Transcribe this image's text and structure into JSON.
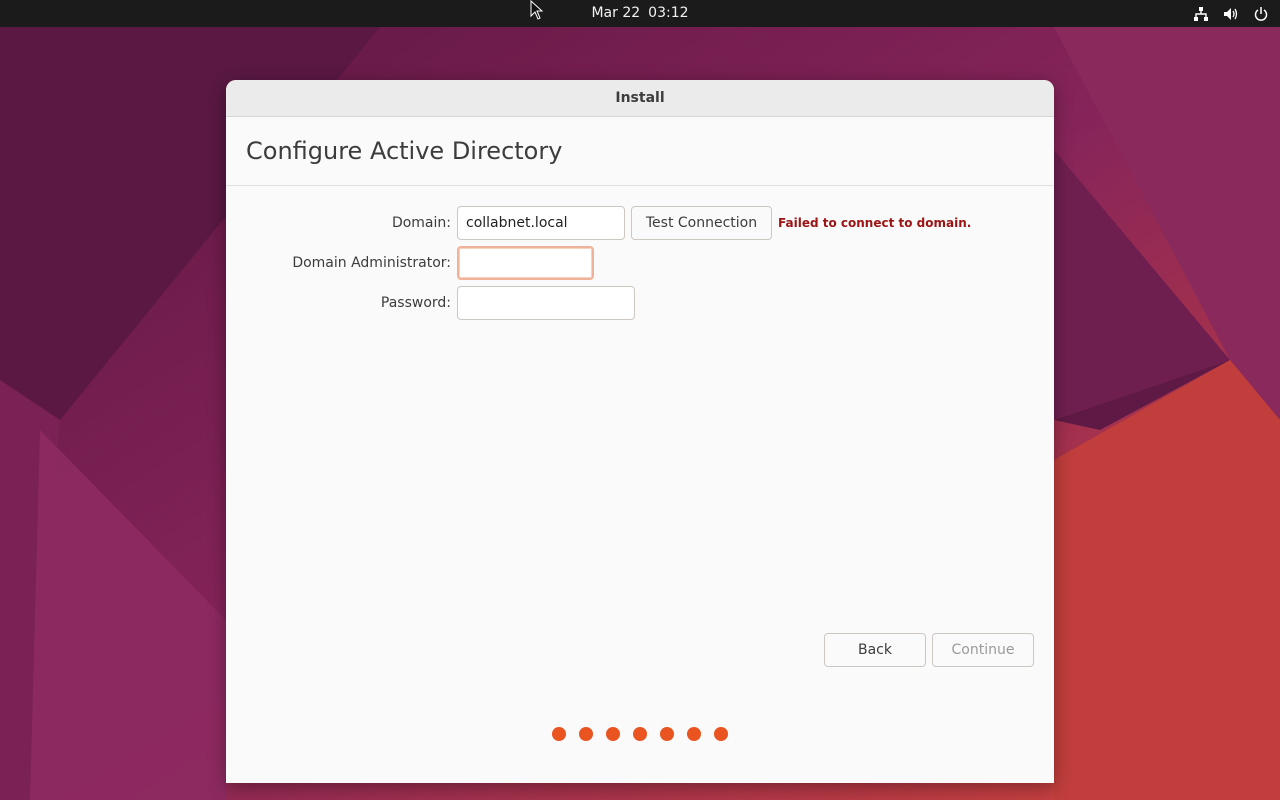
{
  "topbar": {
    "date": "Mar 22",
    "time": "03:12",
    "icons": [
      "network-icon",
      "volume-icon",
      "power-icon"
    ]
  },
  "window": {
    "title": "Install",
    "page_title": "Configure Active Directory"
  },
  "form": {
    "domain_label": "Domain:",
    "domain_value": "collabnet.local",
    "test_connection_label": "Test Connection",
    "error_message": "Failed to connect to domain.",
    "admin_label": "Domain Administrator:",
    "admin_value": "",
    "password_label": "Password:",
    "password_value": ""
  },
  "navigation": {
    "back_label": "Back",
    "continue_label": "Continue"
  },
  "progress": {
    "steps_total": 7,
    "steps_filled": 7
  },
  "colors": {
    "accent": "#e95420",
    "error": "#9c1414",
    "topbar": "#1b1b1b"
  }
}
